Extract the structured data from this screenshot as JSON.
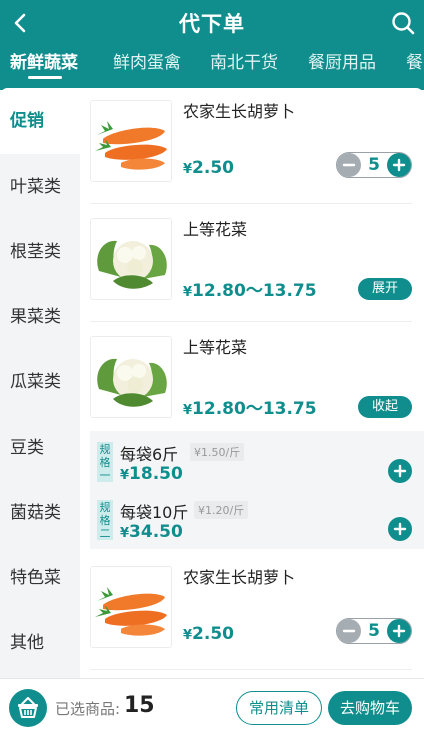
{
  "header": {
    "title": "代下单"
  },
  "tabs": [
    "新鲜蔬菜",
    "鲜肉蛋禽",
    "南北干货",
    "餐厨用品",
    "餐"
  ],
  "categories": [
    "促销",
    "叶菜类",
    "根茎类",
    "果菜类",
    "瓜菜类",
    "豆类",
    "菌菇类",
    "特色菜",
    "其他"
  ],
  "products": [
    {
      "name": "农家生长胡萝卜",
      "currency": "¥",
      "price": "2.50",
      "qty": "5"
    },
    {
      "name": "上等花菜",
      "currency": "¥",
      "price": "12.80～13.75",
      "action": "展开"
    },
    {
      "name": "上等花菜",
      "currency": "¥",
      "price": "12.80～13.75",
      "action": "收起"
    },
    {
      "name": "农家生长胡萝卜",
      "currency": "¥",
      "price": "2.50",
      "qty": "5"
    }
  ],
  "specs": [
    {
      "tag": "规格一",
      "name": "每袋6斤",
      "unit": "¥1.50/斤",
      "currency": "¥",
      "price": "18.50"
    },
    {
      "tag": "规格二",
      "name": "每袋10斤",
      "unit": "¥1.20/斤",
      "currency": "¥",
      "price": "34.50"
    }
  ],
  "footer": {
    "selected_label": "已选商品:",
    "selected_count": "15",
    "common_list": "常用清单",
    "go_cart": "去购物车"
  },
  "colors": {
    "accent": "#0f8e8d"
  }
}
